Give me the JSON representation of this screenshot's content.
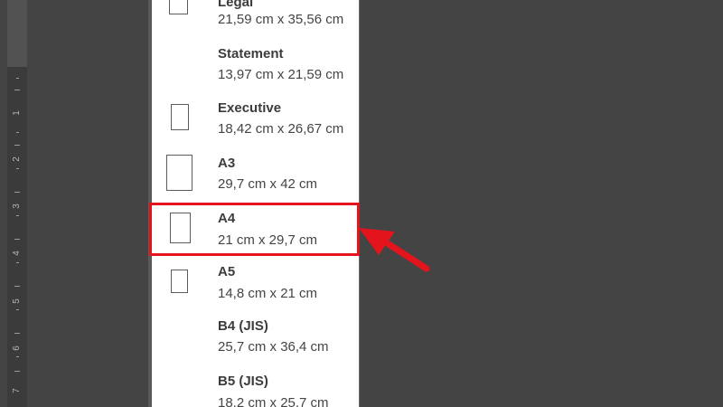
{
  "paper_sizes": [
    {
      "name": "Legal",
      "size": "21,59 cm x 35,56 cm",
      "icon": "portrait-page-icon"
    },
    {
      "name": "Statement",
      "size": "13,97 cm x 21,59 cm",
      "icon": "none"
    },
    {
      "name": "Executive",
      "size": "18,42 cm x 26,67 cm",
      "icon": "portrait-page-icon"
    },
    {
      "name": "A3",
      "size": "29,7 cm x 42 cm",
      "icon": "portrait-page-icon"
    },
    {
      "name": "A4",
      "size": "21 cm x 29,7 cm",
      "icon": "portrait-page-icon",
      "highlighted": true
    },
    {
      "name": "A5",
      "size": "14,8 cm x 21 cm",
      "icon": "portrait-page-icon"
    },
    {
      "name": "B4 (JIS)",
      "size": "25,7 cm x 36,4 cm",
      "icon": "none"
    },
    {
      "name": "B5 (JIS)",
      "size": "18,2 cm x 25,7 cm",
      "icon": "none"
    }
  ],
  "ruler": {
    "numbers": [
      "1",
      "2",
      "3",
      "4",
      "5",
      "6",
      "7"
    ]
  },
  "annotation": {
    "highlight_color": "#e3141b",
    "arrow_color": "#e3141b"
  }
}
